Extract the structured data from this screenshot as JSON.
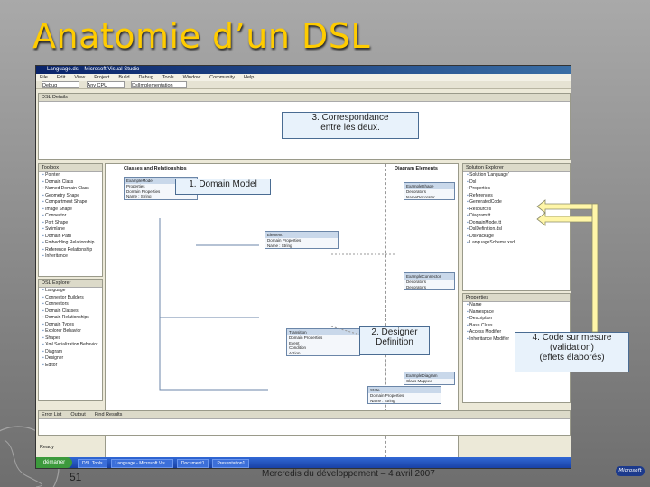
{
  "slide": {
    "title": "Anatomie d’un DSL",
    "page_number": "51",
    "footer": "Mercredis du développement – 4 avril 2007",
    "logo_text": "Microsoft"
  },
  "vs_window": {
    "title": "Language.dsl - Microsoft Visual Studio",
    "menu": [
      "File",
      "Edit",
      "View",
      "Project",
      "Build",
      "Debug",
      "Tools",
      "Window",
      "Community",
      "Help"
    ],
    "toolbar": {
      "config_value": "Debug",
      "platform_value": "Any CPU",
      "find_value": "DslImplementation"
    },
    "details_panel_tab": "DSL Details",
    "toolbox": {
      "header": "Toolbox",
      "items": [
        "Pointer",
        "Domain Class",
        "Named Domain Class",
        "Geometry Shape",
        "Compartment Shape",
        "Image Shape",
        "Connector",
        "Port Shape",
        "Swimlane",
        "Domain Path",
        "Embedding Relationship",
        "Reference Relationship",
        "Inheritance"
      ]
    },
    "explorer": {
      "header": "DSL Explorer",
      "items": [
        "Language",
        "Connector Builders",
        "Connectors",
        "Domain Classes",
        "Domain Relationships",
        "Domain Types",
        "Explorer Behavior",
        "Shapes",
        "Xml Serialization Behavior",
        "Diagram",
        "Designer",
        "Editor"
      ]
    },
    "solution": {
      "header": "Solution Explorer",
      "items": [
        "Solution 'Language'",
        "Dsl",
        "Properties",
        "References",
        "GeneratedCode",
        "Resources",
        "Diagram.tt",
        "DomainModel.tt",
        "DslDefinition.dsl",
        "DslPackage",
        "LanguageSchema.xsd"
      ]
    },
    "properties": {
      "header": "Properties",
      "rows": [
        "Name",
        "Namespace",
        "Description",
        "Base Class",
        "Access Modifier",
        "Inheritance Modifier"
      ]
    },
    "bottom_tabs": [
      "Error List",
      "Output",
      "Find Results"
    ],
    "status": "Ready",
    "taskbar_start": "démarrer",
    "taskbar_items": [
      "DSL Tools",
      "Language - Microsoft Vis...",
      "Document1",
      "Presentation1"
    ]
  },
  "diagram": {
    "header_left": "Classes and Relationships",
    "header_right": "Diagram Elements",
    "classes": [
      {
        "name": "ExampleModel",
        "rows": [
          "Properties",
          "Domain Properties",
          "Name : String"
        ]
      },
      {
        "name": "Element",
        "rows": [
          "Domain Properties",
          "Name : String"
        ]
      },
      {
        "name": "Transition",
        "rows": [
          "Domain Properties",
          "Event",
          "Condition",
          "Action"
        ]
      },
      {
        "name": "State",
        "rows": [
          "Domain Properties",
          "Name : String"
        ]
      }
    ],
    "shapes": [
      {
        "name": "ExampleShape",
        "rows": [
          "Decorators",
          "NameDecorator"
        ]
      },
      {
        "name": "ExampleConnector",
        "rows": [
          "Decorators",
          "Decorators"
        ]
      },
      {
        "name": "ExampleDiagram",
        "rows": [
          "Class Mapped"
        ]
      }
    ]
  },
  "callouts": {
    "correspondance": "3. Correspondance\nentre les deux.",
    "domain_model": "1. Domain Model",
    "designer": "2. Designer\nDefinition",
    "code_sur_mesure": "4. Code sur mesure\n(validation)\n(effets élaborés)"
  },
  "colors": {
    "title": "#ffcc00",
    "callout_bg": "#e8f2fb",
    "arrow": "#fff6a8"
  }
}
